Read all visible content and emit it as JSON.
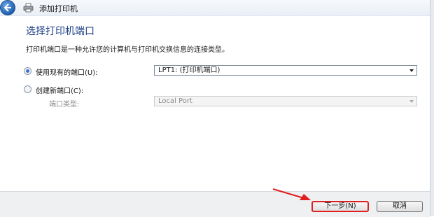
{
  "window": {
    "title": "添加打印机"
  },
  "page": {
    "heading": "选择打印机端口",
    "description": "打印机端口是一种允许您的计算机与打印机交换信息的连接类型。"
  },
  "options": {
    "use_existing": {
      "label": "使用现有的端口(U):",
      "selected": true,
      "value": "LPT1: (打印机端口)"
    },
    "create_new": {
      "label": "创建新端口(C):",
      "selected": false
    },
    "port_type": {
      "label": "端口类型:",
      "value": "Local Port"
    }
  },
  "buttons": {
    "next": "下一步(N)",
    "cancel": "取消"
  },
  "colors": {
    "heading": "#1e3f86",
    "annotation": "#e02020"
  },
  "icons": [
    "back-arrow-icon",
    "printer-icon",
    "dropdown-arrow-icon",
    "annotation-arrow-icon"
  ]
}
